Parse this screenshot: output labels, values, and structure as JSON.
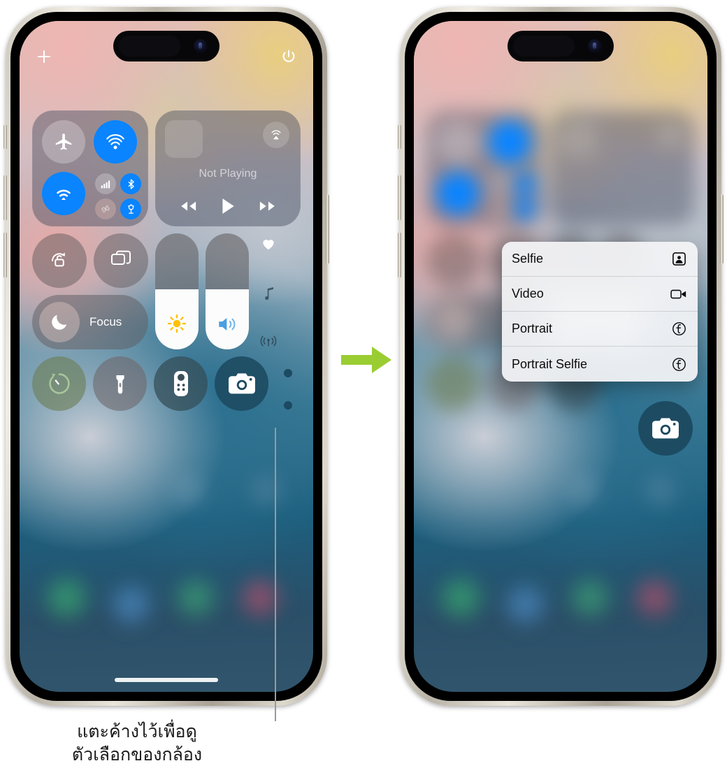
{
  "phones": {
    "left": {
      "label": "Control Center",
      "topbar": {
        "add_label": "plus-icon",
        "power_label": "power-icon"
      },
      "connectivity": {
        "airplane_mode": "Airplane Mode",
        "airdrop": "AirDrop",
        "wifi": "Wi-Fi",
        "cellular": "Cellular Data",
        "bluetooth": "Bluetooth",
        "airdrop_small": "AirDrop",
        "hotspot": "Personal Hotspot"
      },
      "media": {
        "now_playing": "Not Playing",
        "rewind": "Rewind",
        "play": "Play",
        "forward": "Fast Forward",
        "airplay": "AirPlay"
      },
      "toggles": {
        "rotation_lock": "Rotation Lock",
        "screen_mirroring": "Screen Mirroring",
        "focus": "Focus"
      },
      "sliders": {
        "brightness_label": "Brightness",
        "brightness_value": 52,
        "volume_label": "Volume",
        "volume_value": 52
      },
      "rail": {
        "hearing": "Hearing",
        "music_recognition": "Music Recognition",
        "connectivity": "Connectivity"
      },
      "actions": {
        "timer": "Timer",
        "flashlight": "Flashlight",
        "remote": "Apple TV Remote",
        "camera": "Camera"
      },
      "page_dots": 2
    },
    "right": {
      "label": "Control Center with camera options menu",
      "camera": "Camera",
      "menu": {
        "items": [
          {
            "label": "Selfie",
            "icon": "selfie-icon"
          },
          {
            "label": "Video",
            "icon": "video-icon"
          },
          {
            "label": "Portrait",
            "icon": "aperture-icon"
          },
          {
            "label": "Portrait Selfie",
            "icon": "aperture-icon"
          }
        ]
      }
    }
  },
  "arrow": {
    "name": "flow-arrow",
    "color": "#9ACD32"
  },
  "caption": {
    "line1": "แตะค้างไว้เพื่อดู",
    "line2": "ตัวเลือกของกล้อง"
  }
}
